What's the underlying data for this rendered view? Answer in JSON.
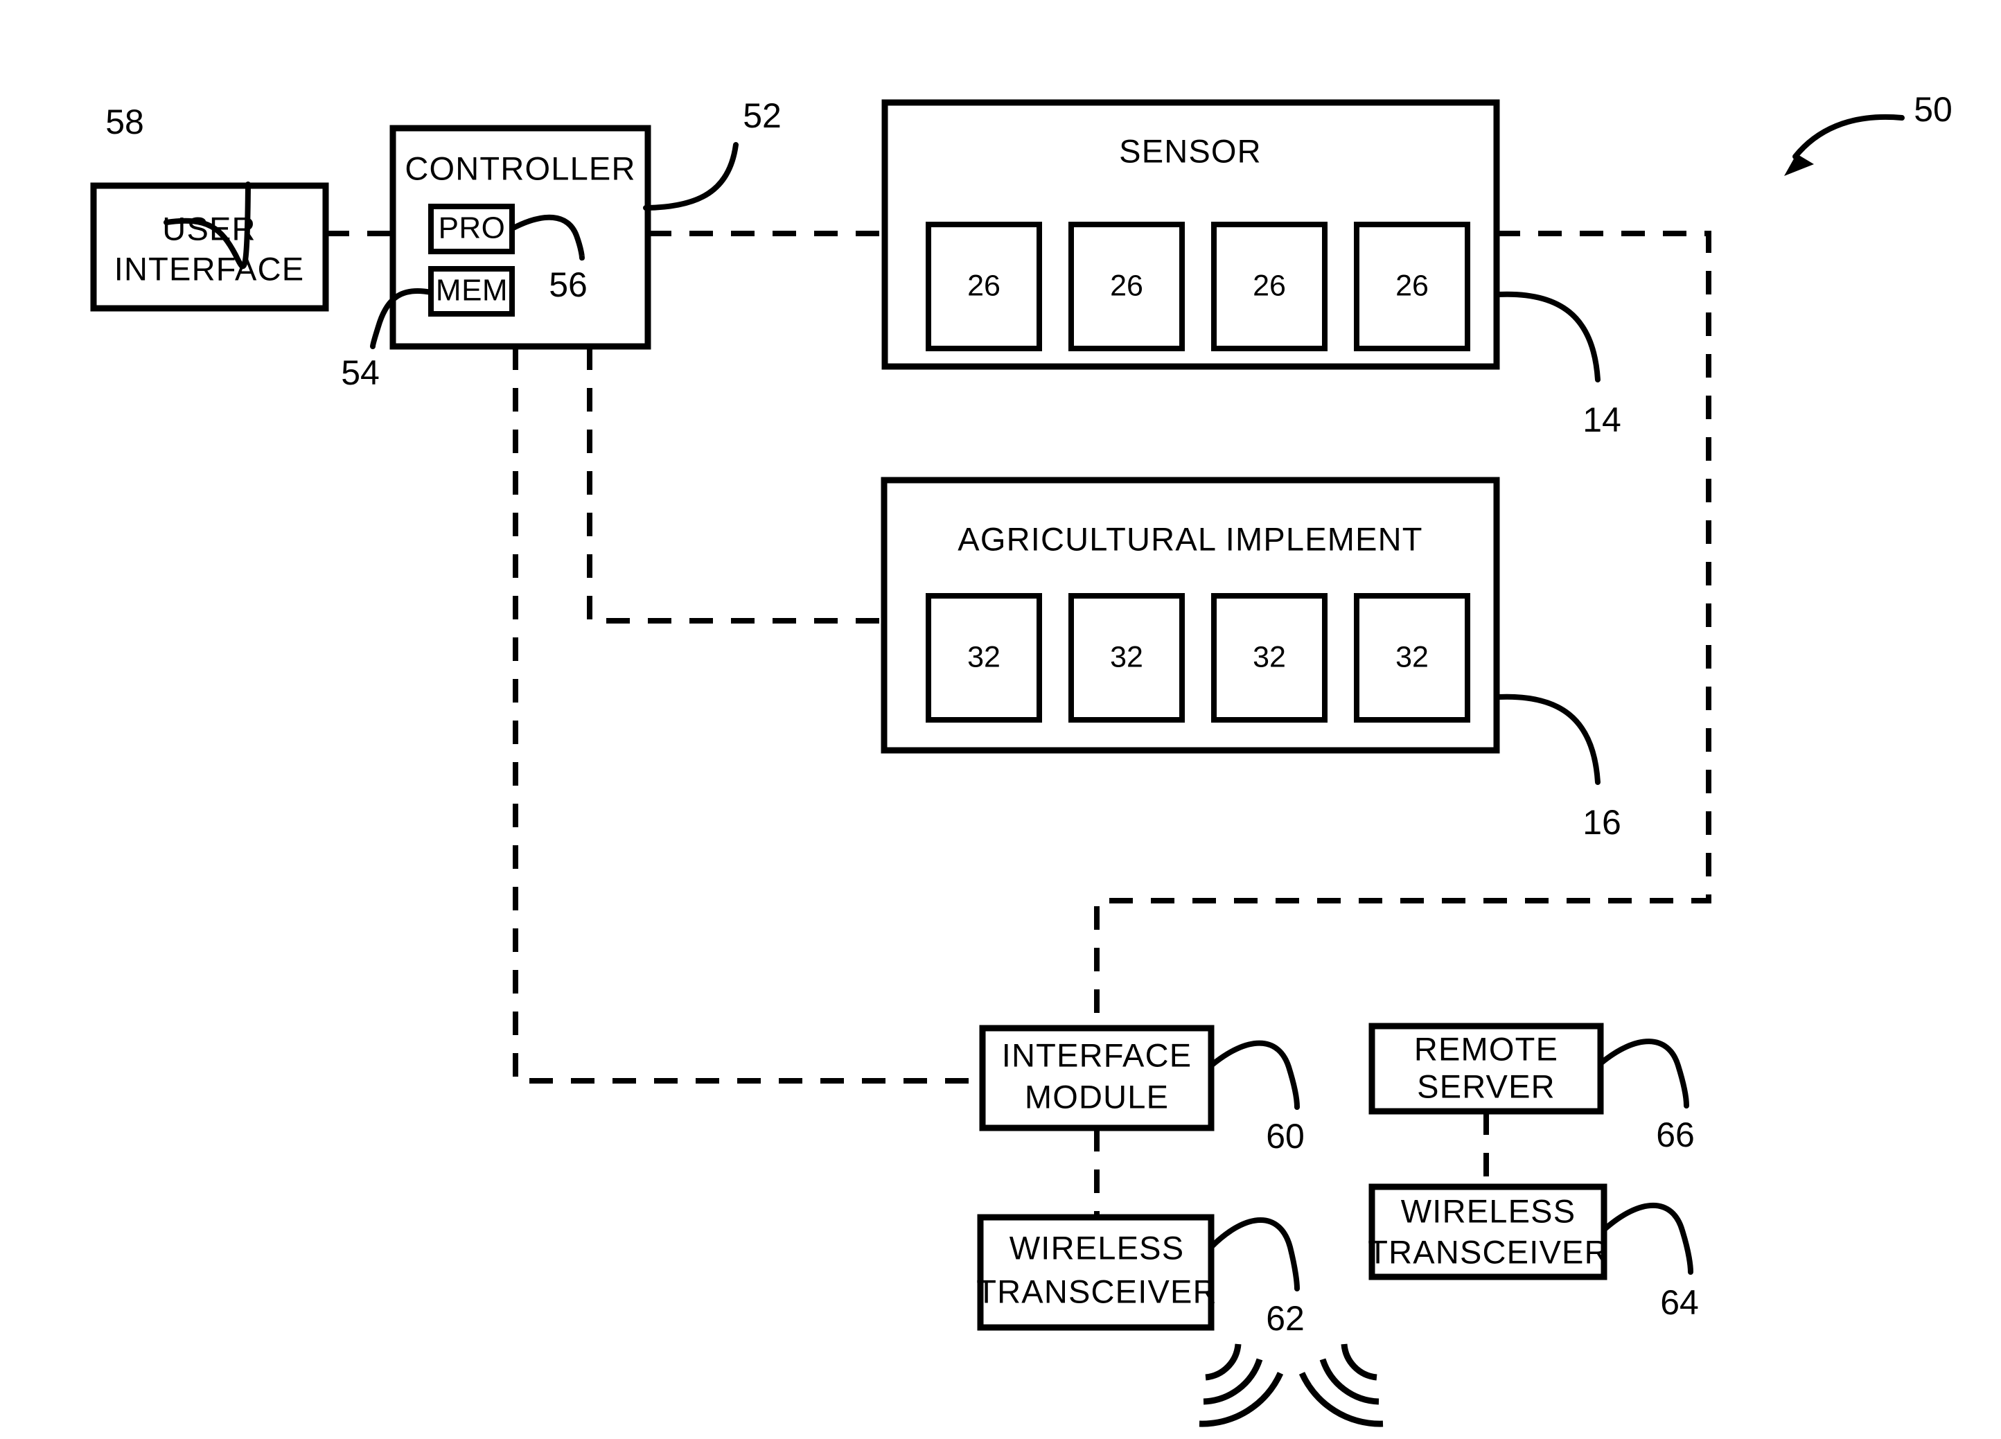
{
  "figure": {
    "reference_numeral": "50",
    "blocks": {
      "user_interface": {
        "label_line1": "USER",
        "label_line2": "INTERFACE",
        "ref": "58"
      },
      "controller": {
        "label": "CONTROLLER",
        "ref": "52"
      },
      "processor": {
        "label": "PRO",
        "ref": "56"
      },
      "memory": {
        "label": "MEM",
        "ref": "54"
      },
      "sensor": {
        "label": "SENSOR",
        "ref": "14"
      },
      "agricultural_implement": {
        "label": "AGRICULTURAL IMPLEMENT",
        "ref": "16"
      },
      "interface_module": {
        "label_line1": "INTERFACE",
        "label_line2": "MODULE",
        "ref": "60"
      },
      "wireless_transceiver_local": {
        "label_line1": "WIRELESS",
        "label_line2": "TRANSCEIVER",
        "ref": "62"
      },
      "remote_server": {
        "label_line1": "REMOTE",
        "label_line2": "SERVER",
        "ref": "66"
      },
      "wireless_transceiver_remote": {
        "label_line1": "WIRELESS",
        "label_line2": "TRANSCEIVER",
        "ref": "64"
      }
    },
    "sensor_units": [
      "26",
      "26",
      "26",
      "26"
    ],
    "implement_units": [
      "32",
      "32",
      "32",
      "32"
    ],
    "colors": {
      "line": "#000000",
      "fill": "#ffffff",
      "background": "#ffffff"
    }
  }
}
